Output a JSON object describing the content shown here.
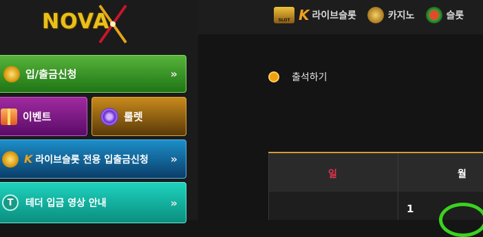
{
  "brand": {
    "logo_text": "NOVA"
  },
  "topnav": [
    {
      "label": "라이브슬롯",
      "badge": "SLOT"
    },
    {
      "label": "카지노"
    },
    {
      "label": "슬롯"
    }
  ],
  "sidebar": {
    "deposit": "입/출금신청",
    "event": "이벤트",
    "roulette": "룰렛",
    "live_slot": "라이브슬롯 전용 입출금신청",
    "tether": "테더 입금 영상 안내",
    "chevron": "»"
  },
  "main": {
    "attendance": "출석하기",
    "calendar": {
      "days": [
        "일",
        "월"
      ],
      "first_date": "1"
    }
  },
  "colors": {
    "sunday": "#e8344a",
    "accent": "#f0a010"
  }
}
